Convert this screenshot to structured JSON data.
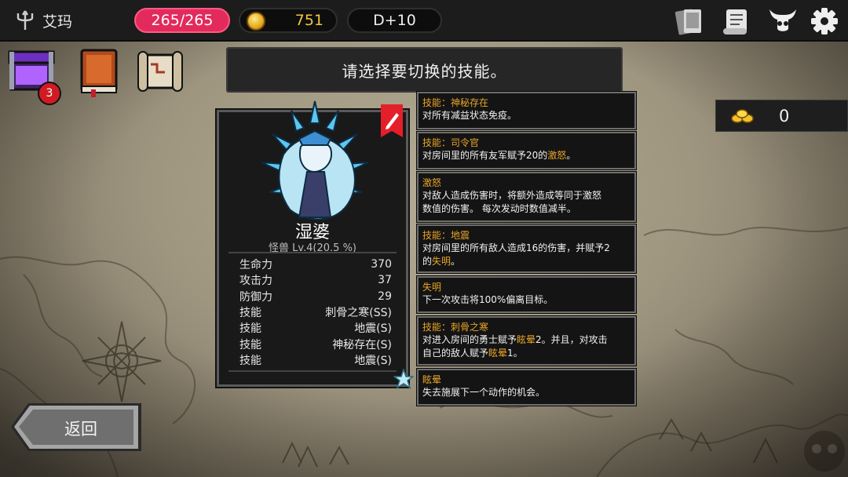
{
  "header": {
    "player_name": "艾玛",
    "hp": "265/265",
    "gold": "751",
    "day": "D+10",
    "icons": [
      "trident-icon",
      "card-deck-icon",
      "scroll-list-icon",
      "demon-horn-icon",
      "gear-icon"
    ]
  },
  "inventory": {
    "chest_badge": "3",
    "icons": [
      "treasure-chest-icon",
      "spell-book-icon",
      "map-scroll-icon"
    ]
  },
  "banner": {
    "text": "请选择要切换的技能。"
  },
  "reward": {
    "value": "0",
    "icon": "gold-pile-icon"
  },
  "monster": {
    "name": "湿婆",
    "level": "怪兽 Lv.4(20.5 %)",
    "stats": [
      {
        "label": "生命力",
        "value": "370"
      },
      {
        "label": "攻击力",
        "value": "37"
      },
      {
        "label": "防御力",
        "value": "29"
      },
      {
        "label": "技能",
        "value": "刺骨之寒(SS)"
      },
      {
        "label": "技能",
        "value": "地震(S)"
      },
      {
        "label": "技能",
        "value": "神秘存在(S)"
      },
      {
        "label": "技能",
        "value": "地震(S)"
      }
    ]
  },
  "skills": [
    {
      "title": "技能：神秘存在",
      "desc": [
        "对所有减益状态免疫。"
      ]
    },
    {
      "title": "技能：司令官",
      "desc": [
        "对房间里的所有友军赋予20的激怒。"
      ]
    },
    {
      "title": "激怒",
      "desc": [
        "对敌人造成伤害时，将额外造成等同于激怒",
        "数值的伤害。 每次发动时数值减半。"
      ]
    },
    {
      "title": "技能：地震",
      "desc": [
        "对房间里的所有敌人造成16的伤害，并赋予2",
        "的失明。"
      ]
    },
    {
      "title": "失明",
      "desc": [
        "下一次攻击将100%偏离目标。"
      ]
    },
    {
      "title": "技能：刺骨之寒",
      "desc": [
        "对进入房间的勇士赋予眩晕2。并且，对攻击",
        "自己的敌人赋予眩晕1。"
      ]
    },
    {
      "title": "眩晕",
      "desc": [
        "失去施展下一个动作的机会。"
      ]
    }
  ],
  "back_button": {
    "label": "返回"
  }
}
